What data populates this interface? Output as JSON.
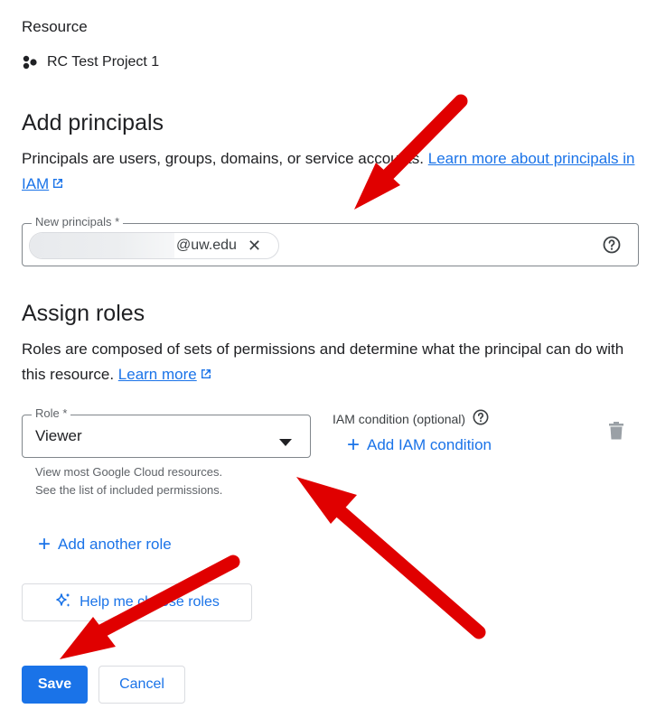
{
  "resource": {
    "heading": "Resource",
    "project_name": "RC Test Project 1",
    "project_icon": "project-hexagon-icon"
  },
  "principals": {
    "heading": "Add principals",
    "description": "Principals are users, groups, domains, or service accounts.",
    "learn_more_link": "Learn more about principals in IAM",
    "field_label": "New principals *",
    "chip_value": "@uw.edu",
    "help_icon": "help-circle-icon"
  },
  "roles": {
    "heading": "Assign roles",
    "description": "Roles are composed of sets of permissions and determine what the principal can do with this resource.",
    "learn_more_link": "Learn more",
    "role_label": "Role *",
    "role_value": "Viewer",
    "role_hint_line1": "View most Google Cloud resources.",
    "role_hint_line2": "See the list of included permissions.",
    "condition_label": "IAM condition (optional)",
    "add_condition_label": "Add IAM condition",
    "add_another_role_label": "Add another role",
    "help_choose_label": "Help me choose roles"
  },
  "actions": {
    "save_label": "Save",
    "cancel_label": "Cancel"
  },
  "colors": {
    "accent": "#1a73e8",
    "annotation_arrow": "#e00000"
  }
}
